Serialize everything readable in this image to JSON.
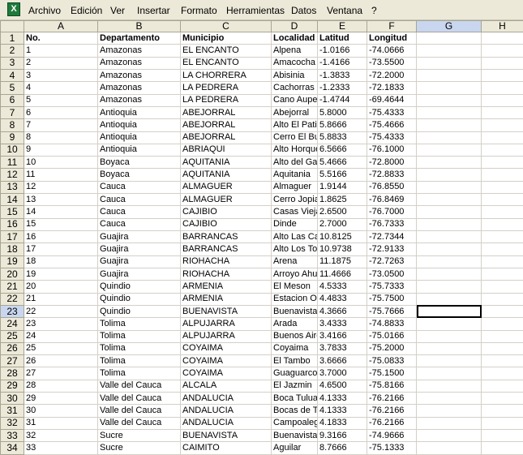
{
  "menubar": {
    "items": [
      "Archivo",
      "Edición",
      "Ver",
      "Insertar",
      "Formato",
      "Herramientas",
      "Datos",
      "Ventana",
      "?"
    ]
  },
  "sheet": {
    "columns": [
      "A",
      "B",
      "C",
      "D",
      "E",
      "F",
      "G",
      "H"
    ],
    "selected_cell": "G23",
    "headers": [
      "No.",
      "Departamento",
      "Municipio",
      "Localidad",
      "Latitud",
      "Longitud"
    ],
    "rows": [
      [
        "1",
        "Amazonas",
        "EL ENCANTO",
        "Alpena",
        "-1.0166",
        "-74.0666"
      ],
      [
        "2",
        "Amazonas",
        "EL ENCANTO",
        "Amacocha",
        "-1.4166",
        "-73.5500"
      ],
      [
        "3",
        "Amazonas",
        "LA CHORRERA",
        "Abisinia",
        "-1.3833",
        "-72.2000"
      ],
      [
        "4",
        "Amazonas",
        "LA PEDRERA",
        "Cachorras",
        "-1.2333",
        "-72.1833"
      ],
      [
        "5",
        "Amazonas",
        "LA PEDRERA",
        "Cano Aupe",
        "-1.4744",
        "-69.4644"
      ],
      [
        "6",
        "Antioquia",
        "ABEJORRAL",
        "Abejorral",
        "5.8000",
        "-75.4333"
      ],
      [
        "7",
        "Antioquia",
        "ABEJORRAL",
        "Alto El Patio",
        "5.8666",
        "-75.4666"
      ],
      [
        "8",
        "Antioquia",
        "ABEJORRAL",
        "Cerro El Buey",
        "5.8833",
        "-75.4333"
      ],
      [
        "9",
        "Antioquia",
        "ABRIAQUI",
        "Alto Horqueta",
        "6.5666",
        "-76.1000"
      ],
      [
        "10",
        "Boyaca",
        "AQUITANIA",
        "Alto del Gallo",
        "5.4666",
        "-72.8000"
      ],
      [
        "11",
        "Boyaca",
        "AQUITANIA",
        "Aquitania",
        "5.5166",
        "-72.8833"
      ],
      [
        "12",
        "Cauca",
        "ALMAGUER",
        "Almaguer",
        "1.9144",
        "-76.8550"
      ],
      [
        "13",
        "Cauca",
        "ALMAGUER",
        "Cerro Jopias",
        "1.8625",
        "-76.8469"
      ],
      [
        "14",
        "Cauca",
        "CAJIBIO",
        "Casas Viejas",
        "2.6500",
        "-76.7000"
      ],
      [
        "15",
        "Cauca",
        "CAJIBIO",
        "Dinde",
        "2.7000",
        "-76.7333"
      ],
      [
        "16",
        "Guajira",
        "BARRANCAS",
        "Alto Las Cabeceras",
        "10.8125",
        "-72.7344"
      ],
      [
        "17",
        "Guajira",
        "BARRANCAS",
        "Alto Los Tocos",
        "10.9738",
        "-72.9133"
      ],
      [
        "18",
        "Guajira",
        "RIOHACHA",
        "Arena",
        "11.1875",
        "-72.7263"
      ],
      [
        "19",
        "Guajira",
        "RIOHACHA",
        "Arroyo Ahumada",
        "11.4666",
        "-73.0500"
      ],
      [
        "20",
        "Quindio",
        "ARMENIA",
        "El Meson",
        "4.5333",
        "-75.7333"
      ],
      [
        "21",
        "Quindio",
        "ARMENIA",
        "Estacion Ortega Diaz",
        "4.4833",
        "-75.7500"
      ],
      [
        "22",
        "Quindio",
        "BUENAVISTA",
        "Buenavista",
        "4.3666",
        "-75.7666"
      ],
      [
        "23",
        "Tolima",
        "ALPUJARRA",
        "Arada",
        "3.4333",
        "-74.8833"
      ],
      [
        "24",
        "Tolima",
        "ALPUJARRA",
        "Buenos Aires",
        "3.4166",
        "-75.0166"
      ],
      [
        "25",
        "Tolima",
        "COYAIMA",
        "Coyaima",
        "3.7833",
        "-75.2000"
      ],
      [
        "26",
        "Tolima",
        "COYAIMA",
        "El Tambo",
        "3.6666",
        "-75.0833"
      ],
      [
        "27",
        "Tolima",
        "COYAIMA",
        "Guaguarco",
        "3.7000",
        "-75.1500"
      ],
      [
        "28",
        "Valle del Cauca",
        "ALCALA",
        "El Jazmin",
        "4.6500",
        "-75.8166"
      ],
      [
        "29",
        "Valle del Cauca",
        "ANDALUCIA",
        "Boca Tulua",
        "4.1333",
        "-76.2166"
      ],
      [
        "30",
        "Valle del Cauca",
        "ANDALUCIA",
        "Bocas de Tulua",
        "4.1333",
        "-76.2166"
      ],
      [
        "31",
        "Valle del Cauca",
        "ANDALUCIA",
        "Campoalegre",
        "4.1833",
        "-76.2166"
      ],
      [
        "32",
        "Sucre",
        "BUENAVISTA",
        "Buenavista",
        "9.3166",
        "-74.9666"
      ],
      [
        "33",
        "Sucre",
        "CAIMITO",
        "Aguilar",
        "8.7666",
        "-75.1333"
      ]
    ]
  }
}
